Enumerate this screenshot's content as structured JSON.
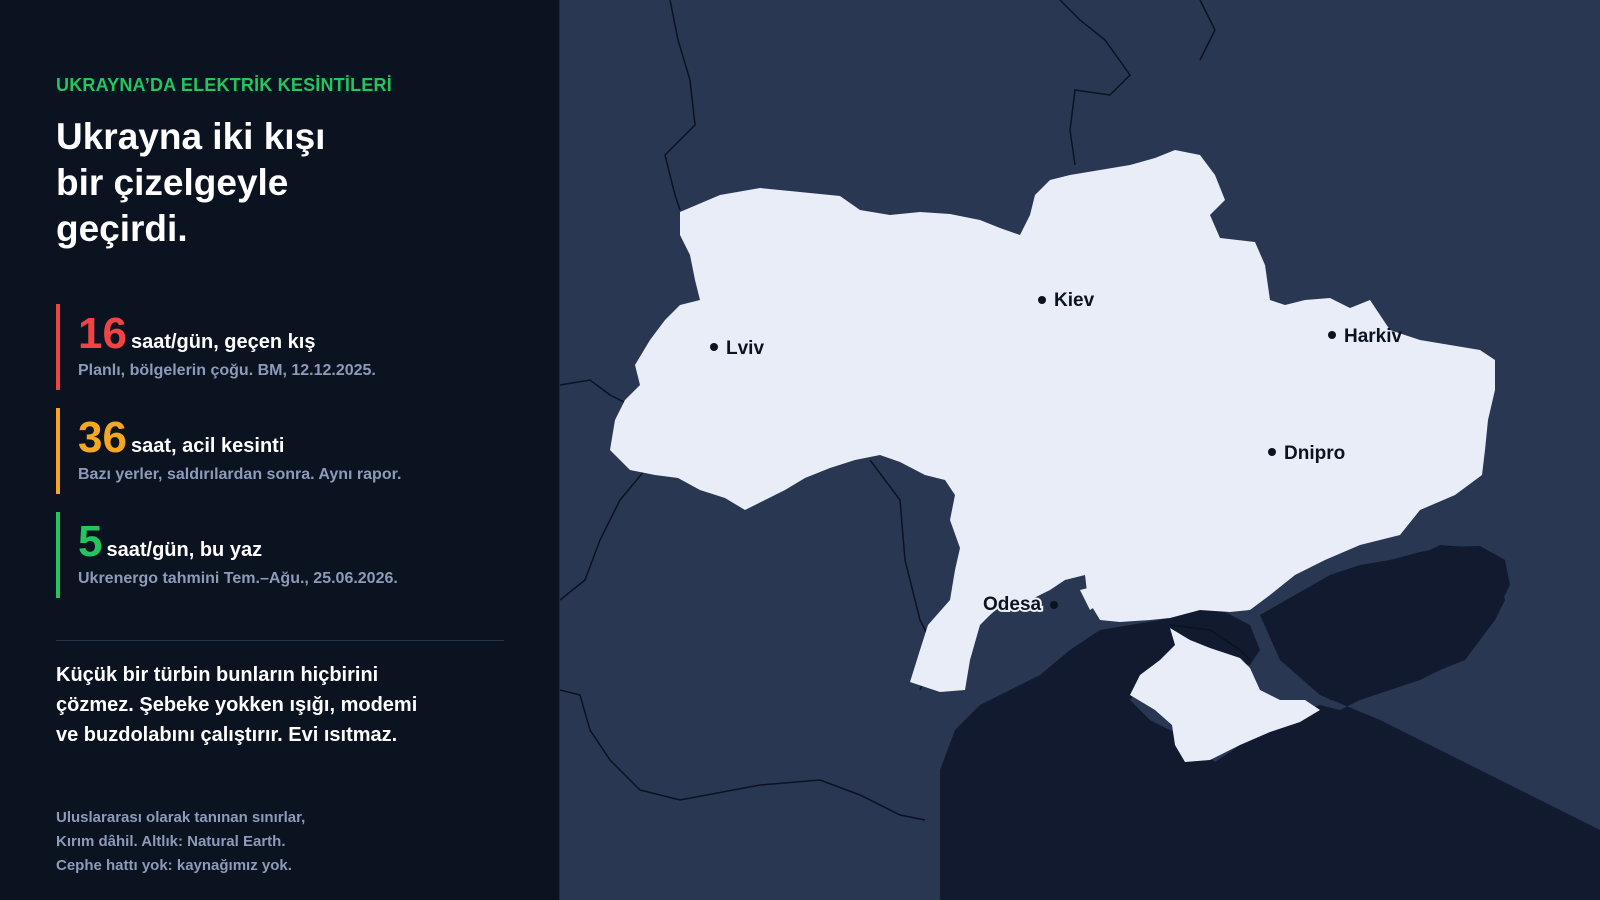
{
  "kicker": "UKRAYNA’DA ELEKTRİK KESİNTİLERİ",
  "headline": [
    "Ukrayna iki kışı",
    "bir çizelgeyle",
    "geçirdi."
  ],
  "stats": [
    {
      "number": "16",
      "unit": "saat/gün, geçen kış",
      "note": "Planlı, bölgelerin çoğu. BM, 12.12.2025.",
      "color": "#ef4444"
    },
    {
      "number": "36",
      "unit": "saat, acil kesinti",
      "note": "Bazı yerler, saldırılardan sonra. Aynı rapor.",
      "color": "#f5a623"
    },
    {
      "number": "5",
      "unit": "saat/gün, bu yaz",
      "note": "Ukrenergo tahmini Tem.–Ağu., 25.06.2026.",
      "color": "#22c55e"
    }
  ],
  "body": "Küçük bir türbin bunların hiçbirini çözmez. Şebeke yokken ışığı, modemi ve buzdolabını çalıştırır. Evi ısıtmaz.",
  "footnote": [
    "Uluslararası olarak tanınan sınırlar,",
    "Kırım dâhil. Altlık: Natural Earth.",
    "Cephe hattı yok: kaynağımız yok."
  ],
  "map": {
    "cities": {
      "kiev": "Kiev",
      "lviv": "Lviv",
      "harkiv": "Harkiv",
      "dnipro": "Dnipro",
      "odesa": "Odesa"
    }
  },
  "colors": {
    "accent_green": "#22c55e",
    "red": "#ef4444",
    "amber": "#f5a623",
    "ukraine_fill": "#e8edf7",
    "neighbor_land": "#2a3753",
    "sea": "#111a2e",
    "panel_bg": "#0b1220"
  }
}
